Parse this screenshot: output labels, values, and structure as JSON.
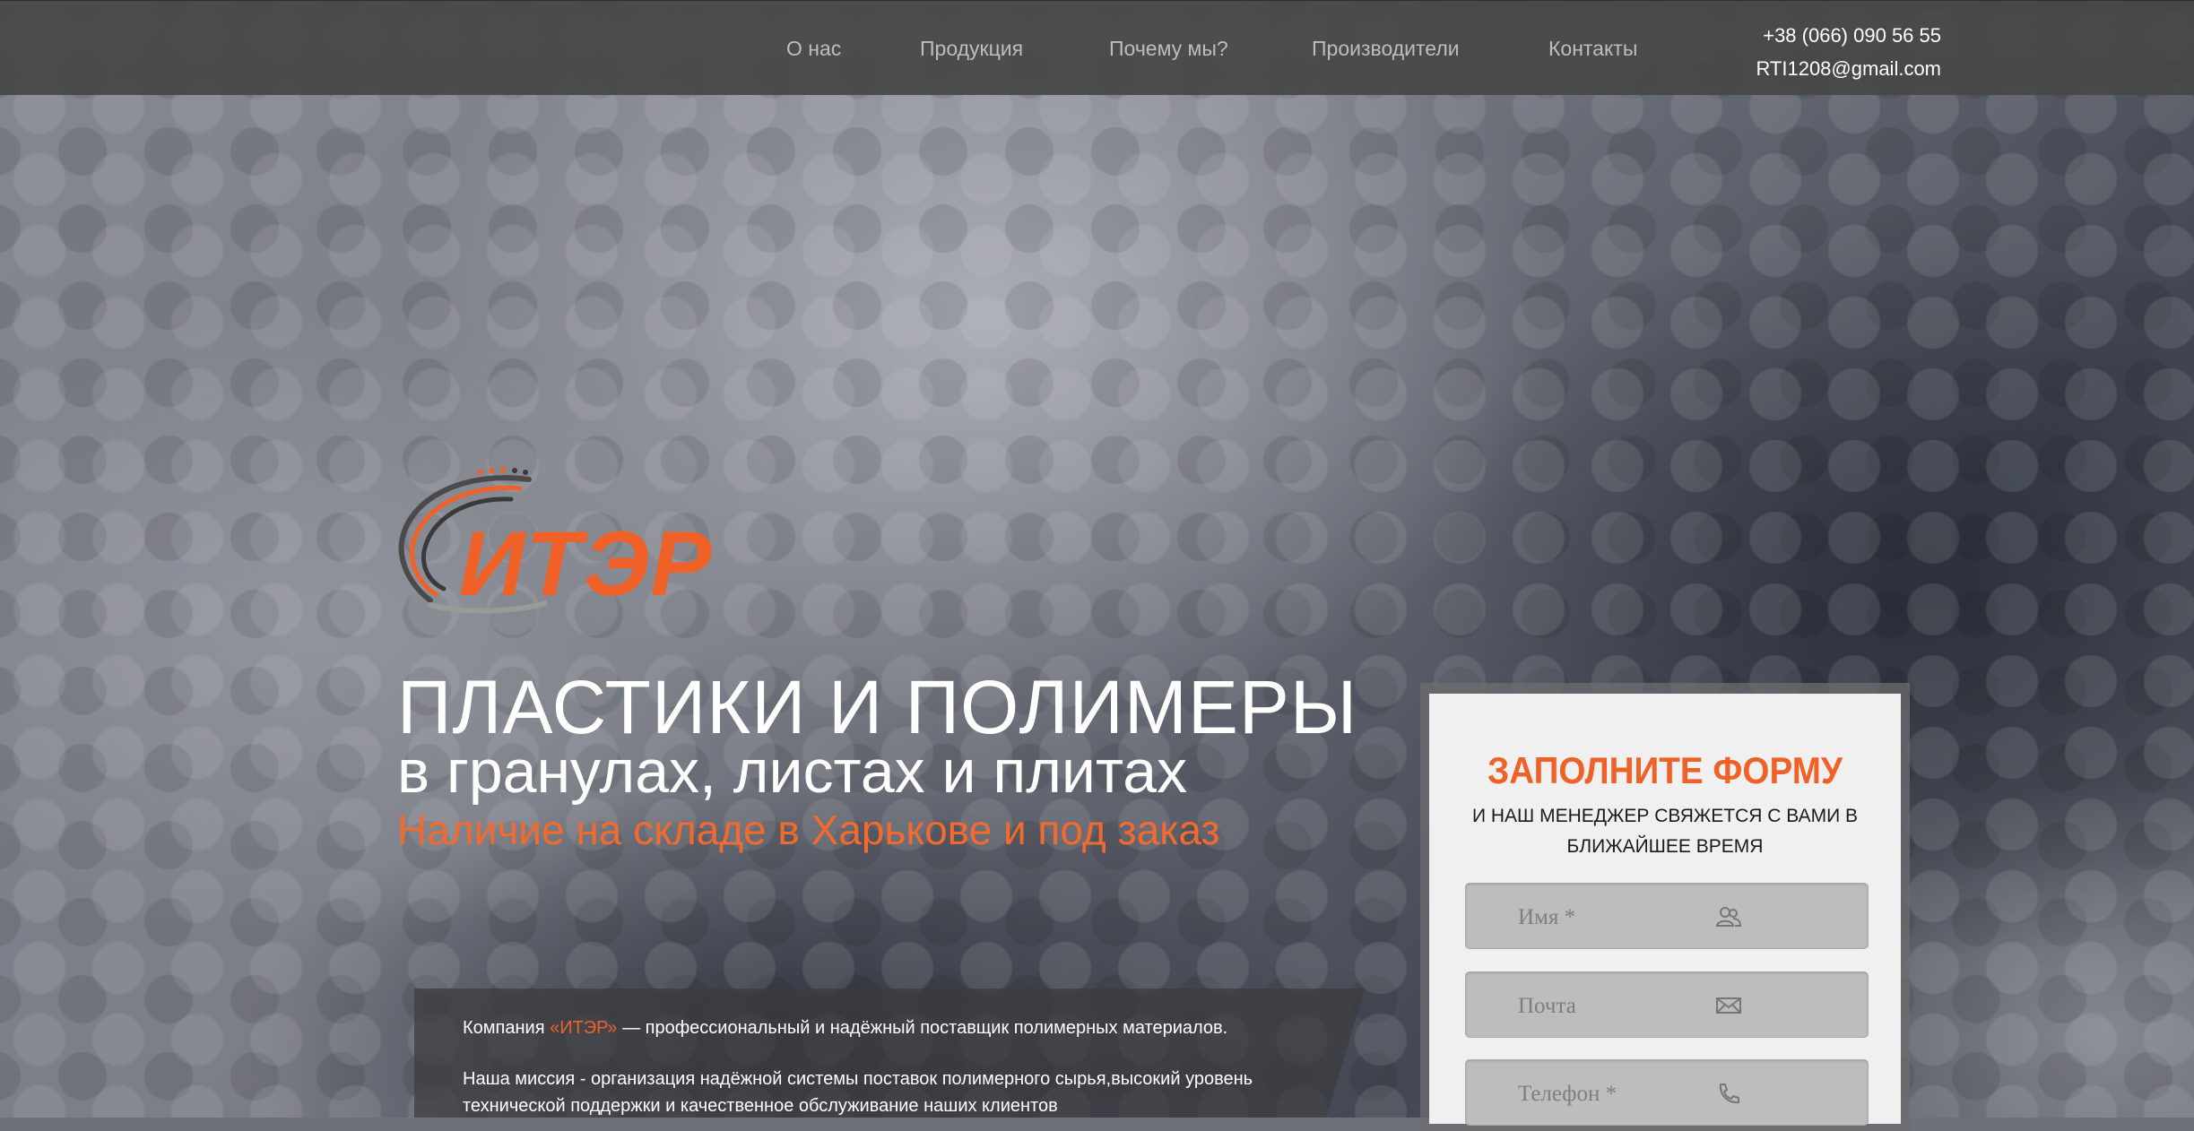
{
  "nav": {
    "items": [
      "О нас",
      "Продукция",
      "Почему мы?",
      "Производители",
      "Контакты"
    ],
    "phone": "+38 (066) 090 56 55",
    "email": "RTI1208@gmail.com"
  },
  "logo": {
    "text": "ИТЭР"
  },
  "hero": {
    "title": "ПЛАСТИКИ И ПОЛИМЕРЫ",
    "subtitle": "в гранулах, листах и плитах",
    "tagline": "Наличие на складе в Харькове и под заказ"
  },
  "info": {
    "intro_prefix": "Компания ",
    "company": "«ИТЭР»",
    "intro_suffix": " — профессиональный и надёжный поставщик полимерных материалов.",
    "mission_line1": "Наша миссия - организация надёжной системы поставок полимерного сырья,высокий уровень",
    "mission_line2": "технической поддержки и качественное обслуживание наших клиентов"
  },
  "form": {
    "title": "ЗАПОЛНИТЕ ФОРМУ",
    "subtitle": "И НАШ МЕНЕДЖЕР СВЯЖЕТСЯ С ВАМИ В БЛИЖАЙШЕЕ ВРЕМЯ",
    "name_placeholder": "Имя  *",
    "email_placeholder": "Почта",
    "phone_placeholder": "Телефон  *"
  },
  "colors": {
    "accent": "#f06128",
    "topbar": "#464646",
    "form_bg": "#f0f0f0",
    "field_bg": "#bdbdbd"
  },
  "icons": [
    "users-icon",
    "envelope-icon",
    "phone-icon"
  ]
}
